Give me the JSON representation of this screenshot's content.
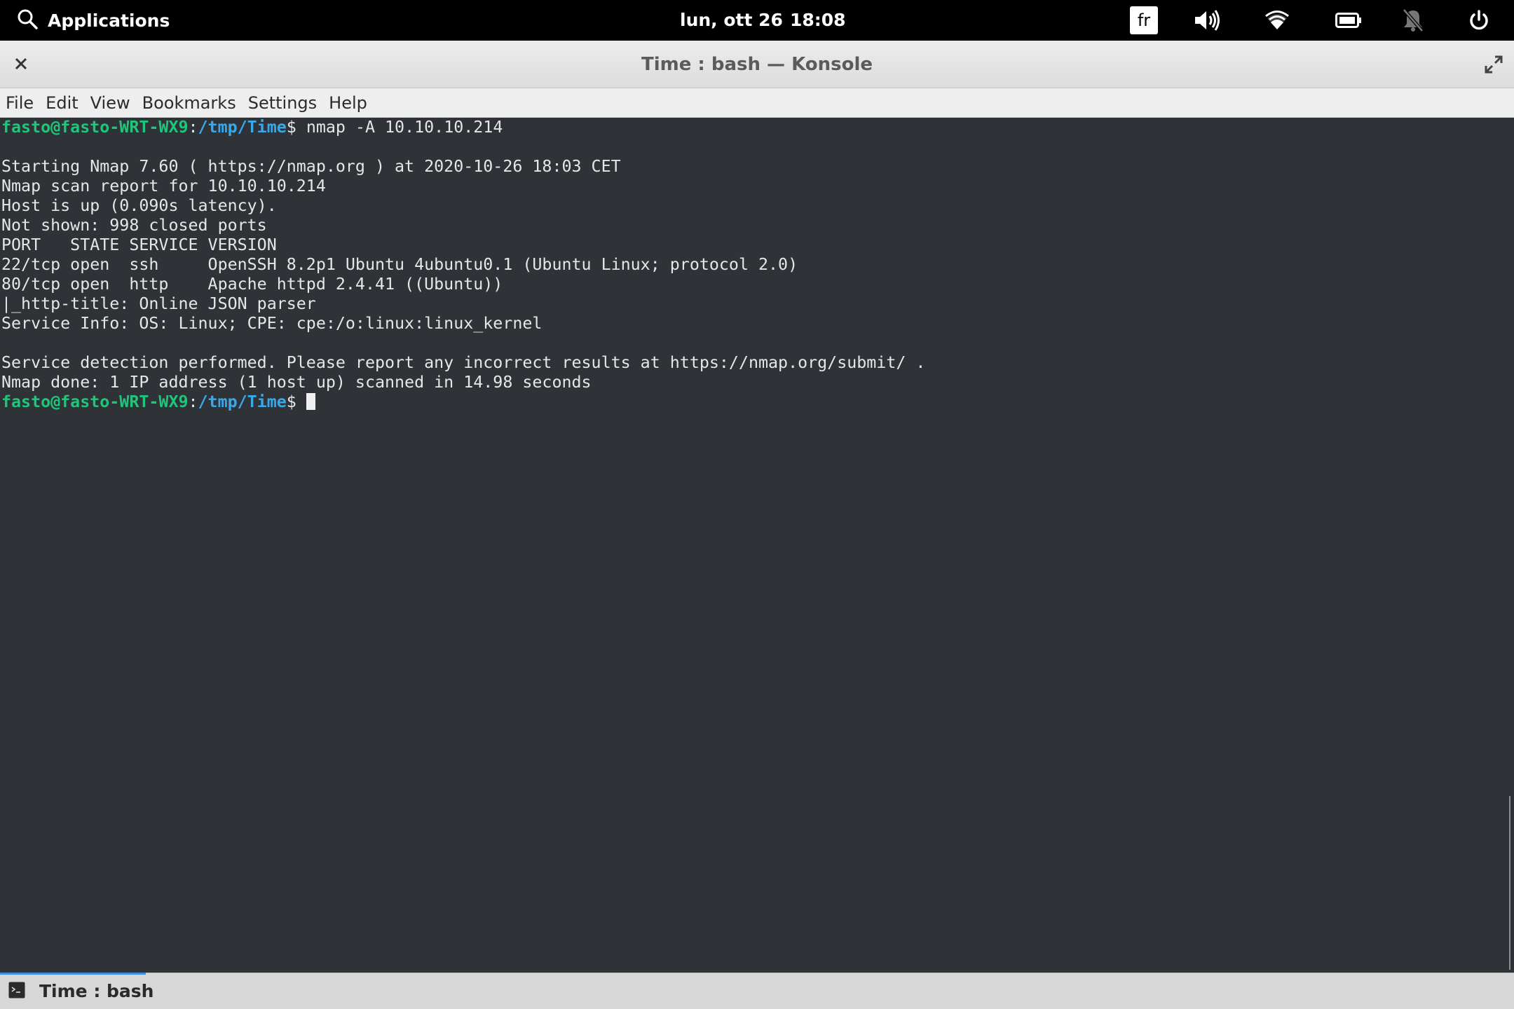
{
  "topbar": {
    "applications_label": "Applications",
    "date": "lun, ott 26",
    "time": "18:08",
    "keyboard_layout": "fr",
    "icons": [
      "search-icon",
      "volume-icon",
      "wifi-icon",
      "battery-icon",
      "notifications-muted-icon",
      "power-icon"
    ]
  },
  "window": {
    "title": "Time : bash — Konsole"
  },
  "menubar": {
    "items": [
      "File",
      "Edit",
      "View",
      "Bookmarks",
      "Settings",
      "Help"
    ]
  },
  "terminal": {
    "prompt_user_host": "fasto@fasto-WRT-WX9",
    "prompt_sep": ":",
    "prompt_path": "/tmp/Time",
    "prompt_symbol": "$ ",
    "command": "nmap -A 10.10.10.214",
    "output_lines": [
      "",
      "Starting Nmap 7.60 ( https://nmap.org ) at 2020-10-26 18:03 CET",
      "Nmap scan report for 10.10.10.214",
      "Host is up (0.090s latency).",
      "Not shown: 998 closed ports",
      "PORT   STATE SERVICE VERSION",
      "22/tcp open  ssh     OpenSSH 8.2p1 Ubuntu 4ubuntu0.1 (Ubuntu Linux; protocol 2.0)",
      "80/tcp open  http    Apache httpd 2.4.41 ((Ubuntu))",
      "|_http-title: Online JSON parser",
      "Service Info: OS: Linux; CPE: cpe:/o:linux:linux_kernel",
      "",
      "Service detection performed. Please report any incorrect results at https://nmap.org/submit/ .",
      "Nmap done: 1 IP address (1 host up) scanned in 14.98 seconds"
    ],
    "colors": {
      "user": "#20c47a",
      "path": "#3aa8e8",
      "text": "#e6e6e6",
      "background": "#2f3337"
    }
  },
  "tabbar": {
    "tab_label": "Time : bash",
    "tab_icon": "terminal-icon",
    "active_color": "#3d8ee6"
  }
}
